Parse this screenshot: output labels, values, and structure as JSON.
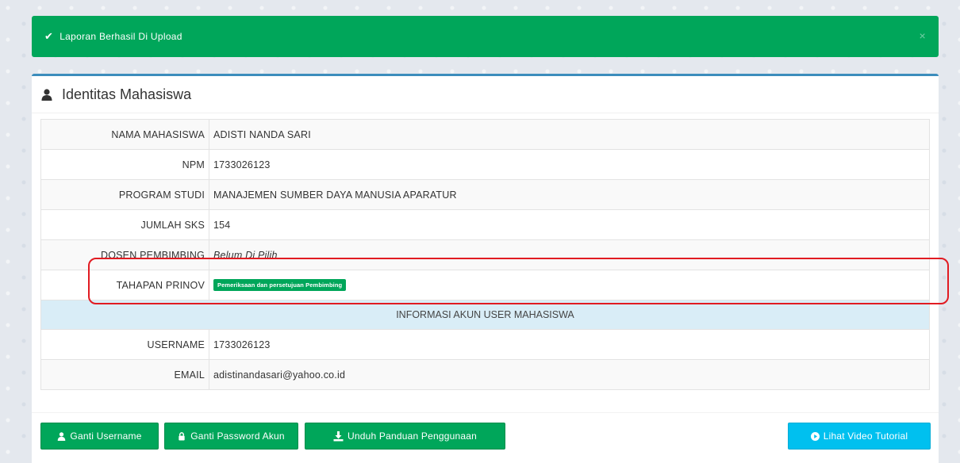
{
  "alert": {
    "message": "Laporan Berhasil Di Upload",
    "close": "×"
  },
  "box": {
    "title": "Identitas Mahasiswa"
  },
  "identity": {
    "rows": [
      {
        "label": "NAMA MAHASISWA",
        "value": "ADISTI NANDA SARI"
      },
      {
        "label": "NPM",
        "value": "1733026123"
      },
      {
        "label": "PROGRAM STUDI",
        "value": "MANAJEMEN SUMBER DAYA MANUSIA APARATUR"
      },
      {
        "label": "JUMLAH SKS",
        "value": "154"
      },
      {
        "label": "DOSEN PEMBIMBING",
        "value": "Belum Di Pilih"
      },
      {
        "label": "TAHAPAN PRINOV",
        "value": "Pemeriksaan dan persetujuan Pembimbing"
      }
    ],
    "section": "INFORMASI AKUN USER MAHASISWA",
    "account": [
      {
        "label": "USERNAME",
        "value": "1733026123"
      },
      {
        "label": "EMAIL",
        "value": "adistinandasari@yahoo.co.id"
      }
    ]
  },
  "buttons": {
    "change_username": "Ganti Username",
    "change_password": "Ganti Password Akun",
    "download_guide": "Unduh Panduan Penggunaan",
    "video_tutorial": "Lihat Video Tutorial"
  },
  "colors": {
    "success": "#00a65a",
    "info": "#00c0ef",
    "primary": "#3c8dbc",
    "highlight": "#e11b22"
  },
  "icons": [
    "check-icon",
    "close-icon",
    "user-icon",
    "lock-icon",
    "download-icon",
    "play-circle-icon"
  ]
}
